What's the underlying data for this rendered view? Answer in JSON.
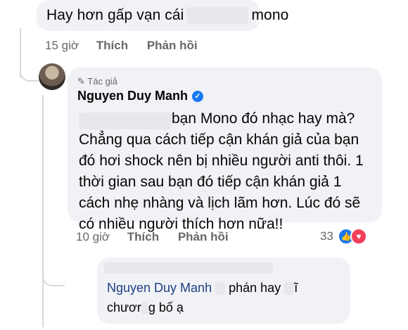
{
  "comment1": {
    "text_before": "Hay hơn gấp vạn cái",
    "text_after": "mono"
  },
  "actions1": {
    "time": "15 giờ",
    "like": "Thích",
    "reply": "Phản hồi"
  },
  "reply1": {
    "author_tag": "Tác giả",
    "author_name": "Nguyen Duy Manh",
    "line1": "bạn Mono đó nhạc hay mà?",
    "body": "Chẳng qua cách tiếp cận khán giả của bạn đó hơi shock nên bị nhiều người anti thôi. 1 thời gian sau bạn đó tiếp cận khán giả 1 cách nhẹ nhàng và lịch lãm hơn. Lúc đó sẽ có nhiều người thích hơn nữa!!"
  },
  "actions2": {
    "time": "10 giờ",
    "like": "Thích",
    "reply": "Phản hồi",
    "reaction_count": "33"
  },
  "reply2": {
    "mention": "Nguyen Duy Manh",
    "line1_text": "phán hay",
    "line1_end": "ĩ",
    "line2_a": "chươr",
    "line2_b": "g bố ạ"
  },
  "colors": {
    "bubble": "#f0f2f5",
    "meta": "#65676b",
    "link": "#1f3f86",
    "like": "#1877f2",
    "love": "#f33e58"
  },
  "icons": {
    "author": "pencil-icon",
    "verified": "verified-badge-icon",
    "like": "like-reaction-icon",
    "love": "love-reaction-icon"
  }
}
